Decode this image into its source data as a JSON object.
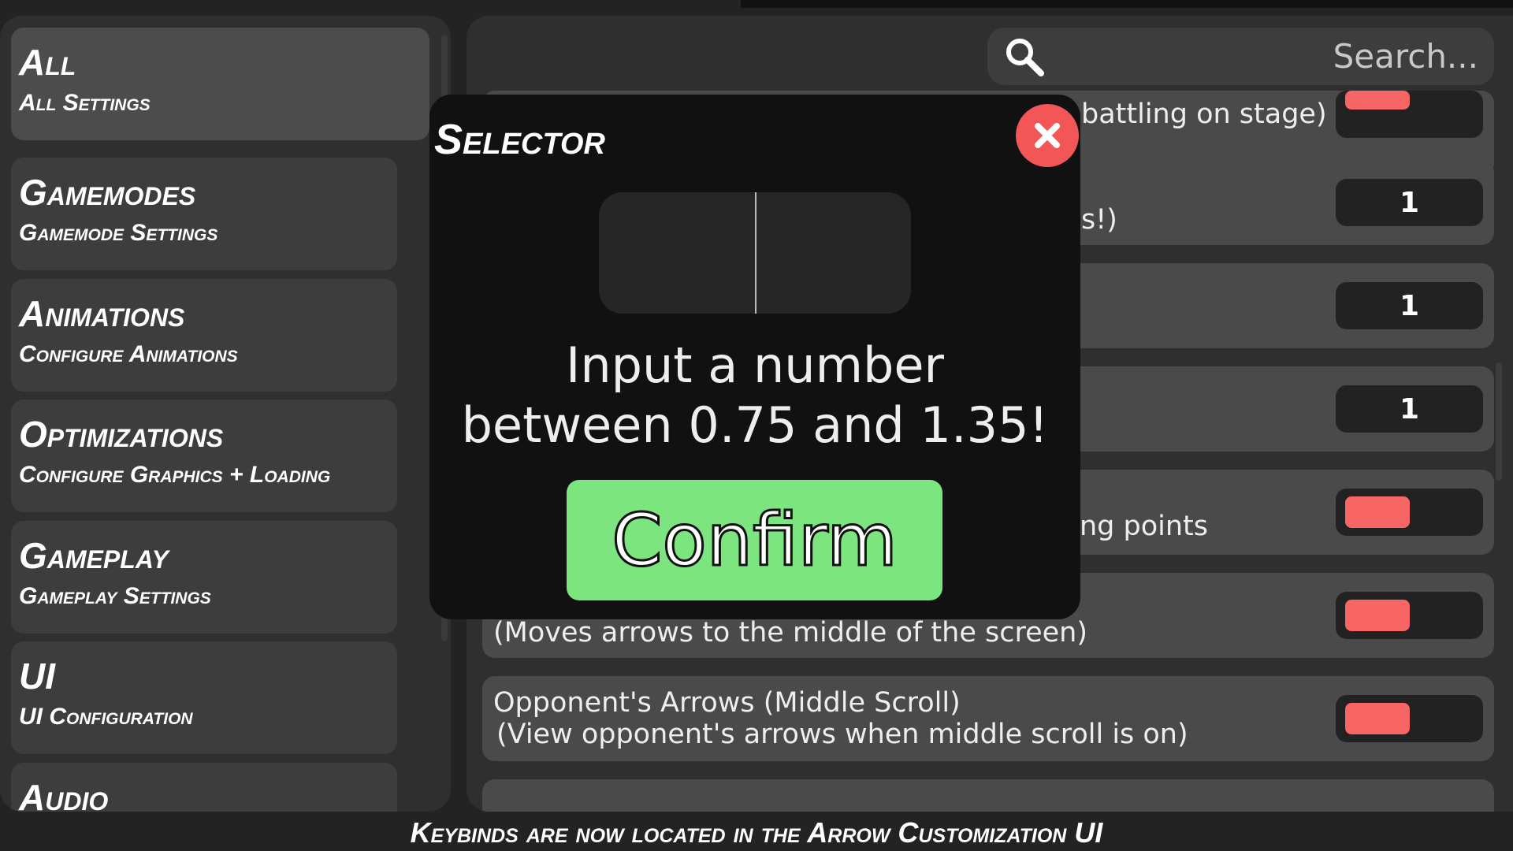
{
  "sidebar": {
    "items": [
      {
        "title": "All",
        "subtitle": "All Settings",
        "active": true
      },
      {
        "title": "Gamemodes",
        "subtitle": "Gamemode Settings"
      },
      {
        "title": "Animations",
        "subtitle": "Configure Animations"
      },
      {
        "title": "Optimizations",
        "subtitle": "Configure Graphics + Loading"
      },
      {
        "title": "Gameplay",
        "subtitle": "Gameplay Settings"
      },
      {
        "title": "UI",
        "subtitle": "UI Configuration"
      },
      {
        "title": "Audio",
        "subtitle": ""
      }
    ]
  },
  "search": {
    "placeholder": "Search...",
    "icon": "search-icon"
  },
  "settings": [
    {
      "text": "battling on stage)",
      "type": "toggle",
      "on": false
    },
    {
      "text": "s!)",
      "type": "value",
      "value": "1"
    },
    {
      "text": "",
      "type": "value",
      "value": "1"
    },
    {
      "text": "",
      "type": "value",
      "value": "1"
    },
    {
      "text": "ng points",
      "type": "toggle",
      "on": false
    },
    {
      "text": "(Moves arrows to the middle of the screen)",
      "type": "toggle",
      "on": false
    },
    {
      "text": "Opponent's Arrows (Middle Scroll)",
      "text2": "(View opponent's arrows when middle scroll is on)",
      "type": "toggle",
      "on": false
    }
  ],
  "modal": {
    "title": "Selector",
    "input_value": "",
    "prompt_line1": "Input a number",
    "prompt_line2": "between 0.75 and 1.35!",
    "confirm_label": "Confirm"
  },
  "footer": "Keybinds are now located in the Arrow Customization UI",
  "colors": {
    "toggle_off": "#f76565",
    "confirm": "#7de57f",
    "close": "#f25656"
  }
}
